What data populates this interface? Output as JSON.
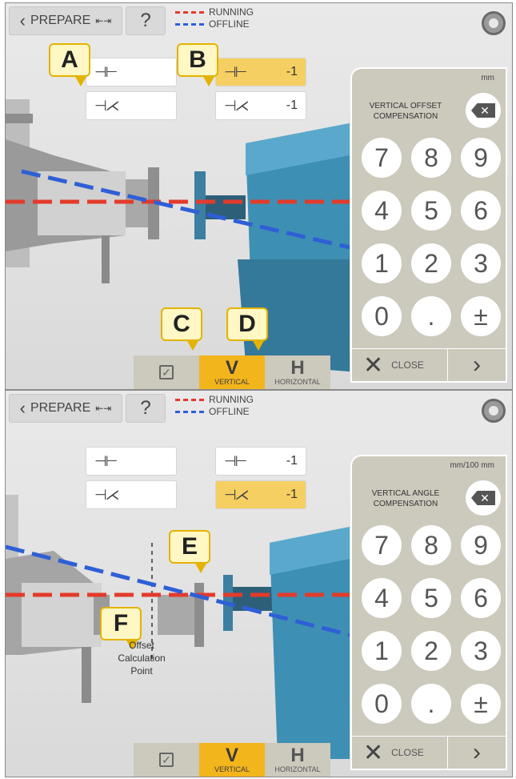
{
  "colors": {
    "running": "#e33b2b",
    "offline": "#2f5fd6",
    "accent": "#f2b51c",
    "motor": "#3e8fb4"
  },
  "icons": [
    "chevron-left-icon",
    "measure-icon",
    "help-icon",
    "gear-icon",
    "backspace-icon",
    "close-icon",
    "chevron-right-icon",
    "checkbox-icon",
    "offset-icon",
    "angle-icon"
  ],
  "panels": [
    {
      "prepare_label": "PREPARE",
      "help_label": "?",
      "legend": {
        "running": "RUNNING",
        "offline": "OFFLINE"
      },
      "fields": [
        {
          "symbol": "⊣⊢",
          "value": ""
        },
        {
          "symbol": "⊣⋌",
          "value": ""
        },
        {
          "symbol": "⊣⊢",
          "value": "-1"
        },
        {
          "symbol": "⊣⋌",
          "value": "-1"
        }
      ],
      "callouts": [
        "A",
        "B",
        "C",
        "D"
      ],
      "keypad": {
        "unit": "mm",
        "title": "VERTICAL OFFSET COMPENSATION",
        "keys": [
          "7",
          "8",
          "9",
          "4",
          "5",
          "6",
          "1",
          "2",
          "3",
          "0",
          ".",
          "±"
        ],
        "close_label": "CLOSE",
        "next_label": "›"
      },
      "modes": {
        "v_label": "V",
        "v_sub": "VERTICAL",
        "h_label": "H",
        "h_sub": "HORIZONTAL"
      }
    },
    {
      "prepare_label": "PREPARE",
      "help_label": "?",
      "legend": {
        "running": "RUNNING",
        "offline": "OFFLINE"
      },
      "fields": [
        {
          "symbol": "⊣⊢",
          "value": ""
        },
        {
          "symbol": "⊣⋌",
          "value": ""
        },
        {
          "symbol": "⊣⊢",
          "value": "-1"
        },
        {
          "symbol": "⊣⋌",
          "value": "-1"
        }
      ],
      "callouts": [
        "E",
        "F"
      ],
      "offset_point_label": "Offset Calculation Point",
      "keypad": {
        "unit": "mm/100 mm",
        "title": "VERTICAL ANGLE COMPENSATION",
        "keys": [
          "7",
          "8",
          "9",
          "4",
          "5",
          "6",
          "1",
          "2",
          "3",
          "0",
          ".",
          "±"
        ],
        "close_label": "CLOSE",
        "next_label": "›"
      },
      "modes": {
        "v_label": "V",
        "v_sub": "VERTICAL",
        "h_label": "H",
        "h_sub": "HORIZONTAL"
      }
    }
  ]
}
